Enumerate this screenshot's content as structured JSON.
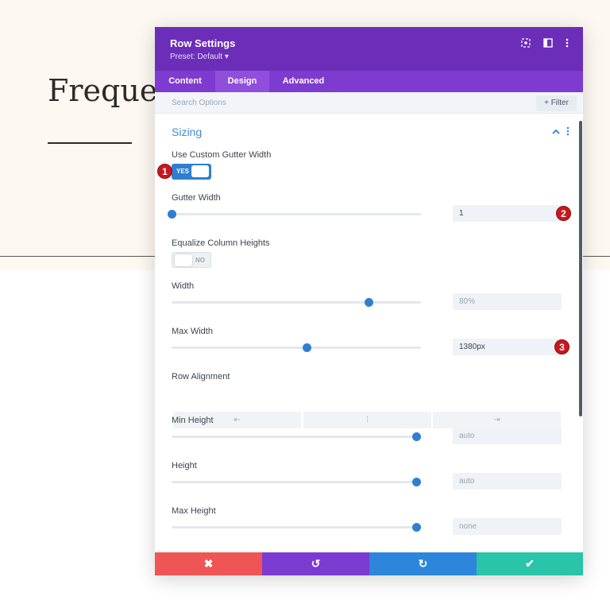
{
  "background": {
    "title": "Frequen"
  },
  "modal": {
    "title": "Row Settings",
    "preset": "Preset: Default ▾",
    "header_icons": [
      "target-icon",
      "sidebar-icon",
      "more-vert-icon"
    ],
    "tabs": [
      {
        "label": "Content",
        "active": false
      },
      {
        "label": "Design",
        "active": true
      },
      {
        "label": "Advanced",
        "active": false
      }
    ],
    "search": {
      "placeholder": "Search Options",
      "filter_label": "+ Filter"
    },
    "section": {
      "title": "Sizing"
    },
    "fields": {
      "custom_gutter": {
        "label": "Use Custom Gutter Width",
        "state": "YES"
      },
      "gutter_width": {
        "label": "Gutter Width",
        "value": "1",
        "slider": 0.0
      },
      "equalize": {
        "label": "Equalize Column Heights",
        "state": "NO"
      },
      "width": {
        "label": "Width",
        "value": "80%",
        "slider": 0.79
      },
      "max_width": {
        "label": "Max Width",
        "value": "1380px",
        "slider": 0.54
      },
      "row_alignment": {
        "label": "Row Alignment",
        "options": [
          "⇤",
          "⁞",
          "⇥"
        ]
      },
      "min_height": {
        "label": "Min Height",
        "value": "auto",
        "slider": 0.98
      },
      "height": {
        "label": "Height",
        "value": "auto",
        "slider": 0.98
      },
      "max_height": {
        "label": "Max Height",
        "value": "none",
        "slider": 0.98
      }
    },
    "badges": [
      "1",
      "2",
      "3"
    ],
    "footer": {
      "cancel": "✖",
      "undo": "↺",
      "redo": "↻",
      "save": "✔"
    }
  },
  "colors": {
    "header": "#6c2eb9",
    "tabs": "#7e3bd0",
    "accent_blue": "#2f7fd1",
    "cancel": "#ef5555",
    "undo": "#7b3bd1",
    "redo": "#2d86db",
    "save": "#29c4a9",
    "badge": "#c8171e"
  }
}
